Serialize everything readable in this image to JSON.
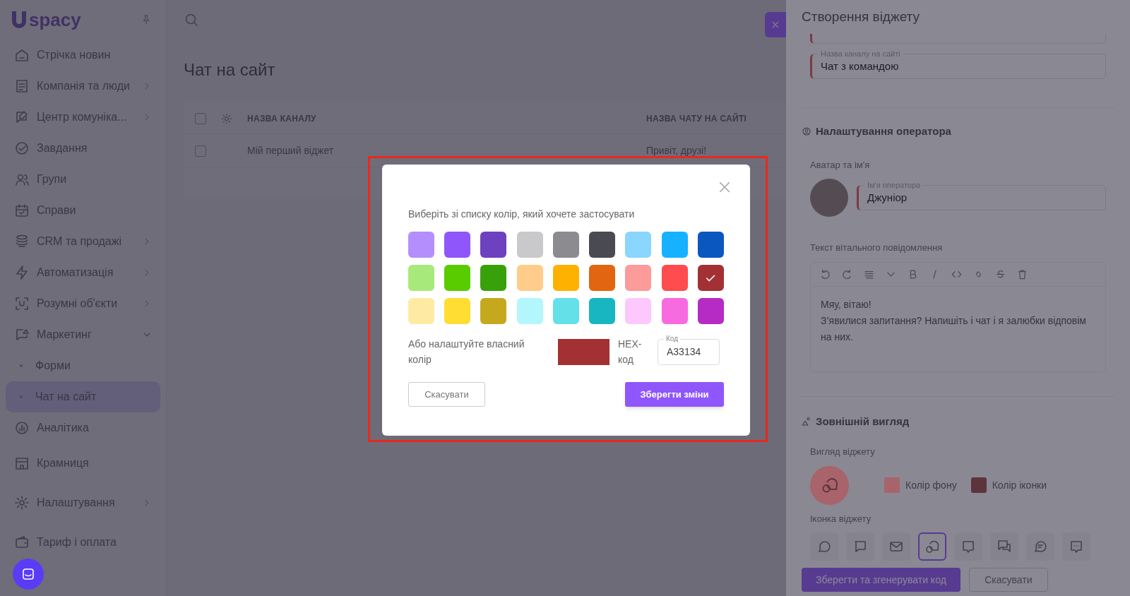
{
  "sidebar": {
    "logo": "spacy",
    "items": [
      {
        "label": "Стрічка новин",
        "kind": "item",
        "expandable": false,
        "selected": false
      },
      {
        "label": "Компанія та люди",
        "kind": "item",
        "expandable": true,
        "expanded": false,
        "selected": false
      },
      {
        "label": "Центр комуніка...",
        "kind": "item",
        "expandable": true,
        "expanded": false,
        "selected": false
      },
      {
        "label": "Завдання",
        "kind": "item",
        "expandable": false,
        "selected": false
      },
      {
        "label": "Групи",
        "kind": "item",
        "expandable": false,
        "selected": false
      },
      {
        "label": "Справи",
        "kind": "item",
        "expandable": false,
        "selected": false
      },
      {
        "label": "CRM та продажі",
        "kind": "item",
        "expandable": true,
        "expanded": false,
        "selected": false
      },
      {
        "label": "Автоматизація",
        "kind": "item",
        "expandable": true,
        "expanded": false,
        "selected": false
      },
      {
        "label": "Розумні об'єкти",
        "kind": "item",
        "expandable": true,
        "expanded": false,
        "selected": false
      },
      {
        "label": "Маркетинг",
        "kind": "item",
        "expandable": true,
        "expanded": true,
        "selected": false
      },
      {
        "label": "Форми",
        "kind": "subitem",
        "expandable": false,
        "selected": false
      },
      {
        "label": "Чат на сайт",
        "kind": "subitem",
        "expandable": false,
        "selected": true
      },
      {
        "label": "Аналітика",
        "kind": "item",
        "expandable": false,
        "selected": false
      },
      {
        "label": "Крамниця",
        "kind": "item",
        "expandable": false,
        "selected": false
      },
      {
        "label": "Налаштування",
        "kind": "item",
        "expandable": true,
        "expanded": false,
        "selected": false
      },
      {
        "label": "Тариф і оплата",
        "kind": "item",
        "expandable": false,
        "selected": false
      }
    ]
  },
  "main": {
    "title": "Чат на сайт",
    "table": {
      "all_checked": false,
      "columns": [
        "НАЗВА КАНАЛУ",
        "НАЗВА ЧАТУ НА САЙТІ"
      ],
      "rows": [
        {
          "cells": [
            "Мій перший віджет",
            "Привіт, друзі!"
          ],
          "checked": false
        }
      ]
    }
  },
  "drawer": {
    "title": "Створення віджету",
    "channel_field": {
      "label": "Назва каналу на сайті",
      "value": "Чат з командою"
    },
    "operator": {
      "heading": "Налаштування оператора",
      "avatar_label": "Аватар та ім'я",
      "name_field": {
        "label": "Ім'я оператора",
        "value": "Джуніор"
      },
      "message_label": "Текст вітального повідомлення",
      "message": [
        "Мяу, вітаю!",
        "З’явилися запитання? Напишіть і чат і я залюбки відповім на них."
      ]
    },
    "appearance": {
      "heading": "Зовнішній вигляд",
      "view_label": "Вигляд віджету",
      "background": {
        "label": "Колір фону",
        "color": "#a9636b"
      },
      "icon_color": {
        "label": "Колір іконки",
        "color": "#5e343c"
      },
      "icons_label": "Іконка віджету",
      "icons": [
        {
          "selected": false
        },
        {
          "selected": false
        },
        {
          "selected": false
        },
        {
          "selected": true
        },
        {
          "selected": false
        },
        {
          "selected": false
        },
        {
          "selected": false
        },
        {
          "selected": false
        }
      ]
    },
    "buttons": {
      "save": "Зберегти та згенерувати код",
      "cancel": "Скасувати"
    }
  },
  "modal": {
    "prompt": "Виберіть зі списку колір, який хочете застосувати",
    "colors": [
      {
        "color": "#b48efd",
        "selected": false
      },
      {
        "color": "#8f56fc",
        "selected": false
      },
      {
        "color": "#6d41bf",
        "selected": false
      },
      {
        "color": "#c9c9cc",
        "selected": false
      },
      {
        "color": "#8b8b90",
        "selected": false
      },
      {
        "color": "#4a4a52",
        "selected": false
      },
      {
        "color": "#8ad6ff",
        "selected": false
      },
      {
        "color": "#16b2ff",
        "selected": false
      },
      {
        "color": "#0b57c0",
        "selected": false
      },
      {
        "color": "#a8e97b",
        "selected": false
      },
      {
        "color": "#59cc00",
        "selected": false
      },
      {
        "color": "#38a10a",
        "selected": false
      },
      {
        "color": "#ffcd89",
        "selected": false
      },
      {
        "color": "#ffb101",
        "selected": false
      },
      {
        "color": "#e26511",
        "selected": false
      },
      {
        "color": "#fd9a9a",
        "selected": false
      },
      {
        "color": "#ff4c4e",
        "selected": false
      },
      {
        "color": "#a33134",
        "selected": true
      },
      {
        "color": "#ffeaa3",
        "selected": false
      },
      {
        "color": "#ffdd33",
        "selected": false
      },
      {
        "color": "#c4a91e",
        "selected": false
      },
      {
        "color": "#b3f7fd",
        "selected": false
      },
      {
        "color": "#63e0e8",
        "selected": false
      },
      {
        "color": "#17b6c0",
        "selected": false
      },
      {
        "color": "#fdc8fd",
        "selected": false
      },
      {
        "color": "#f86ae0",
        "selected": false
      },
      {
        "color": "#b52bc3",
        "selected": false
      }
    ],
    "custom_label": "Або налаштуйте власний колір",
    "hex_label": "HEX-код",
    "code_field": {
      "label": "Код",
      "value": "A33134"
    },
    "cancel": "Скасувати",
    "save": "Зберегти зміни"
  }
}
